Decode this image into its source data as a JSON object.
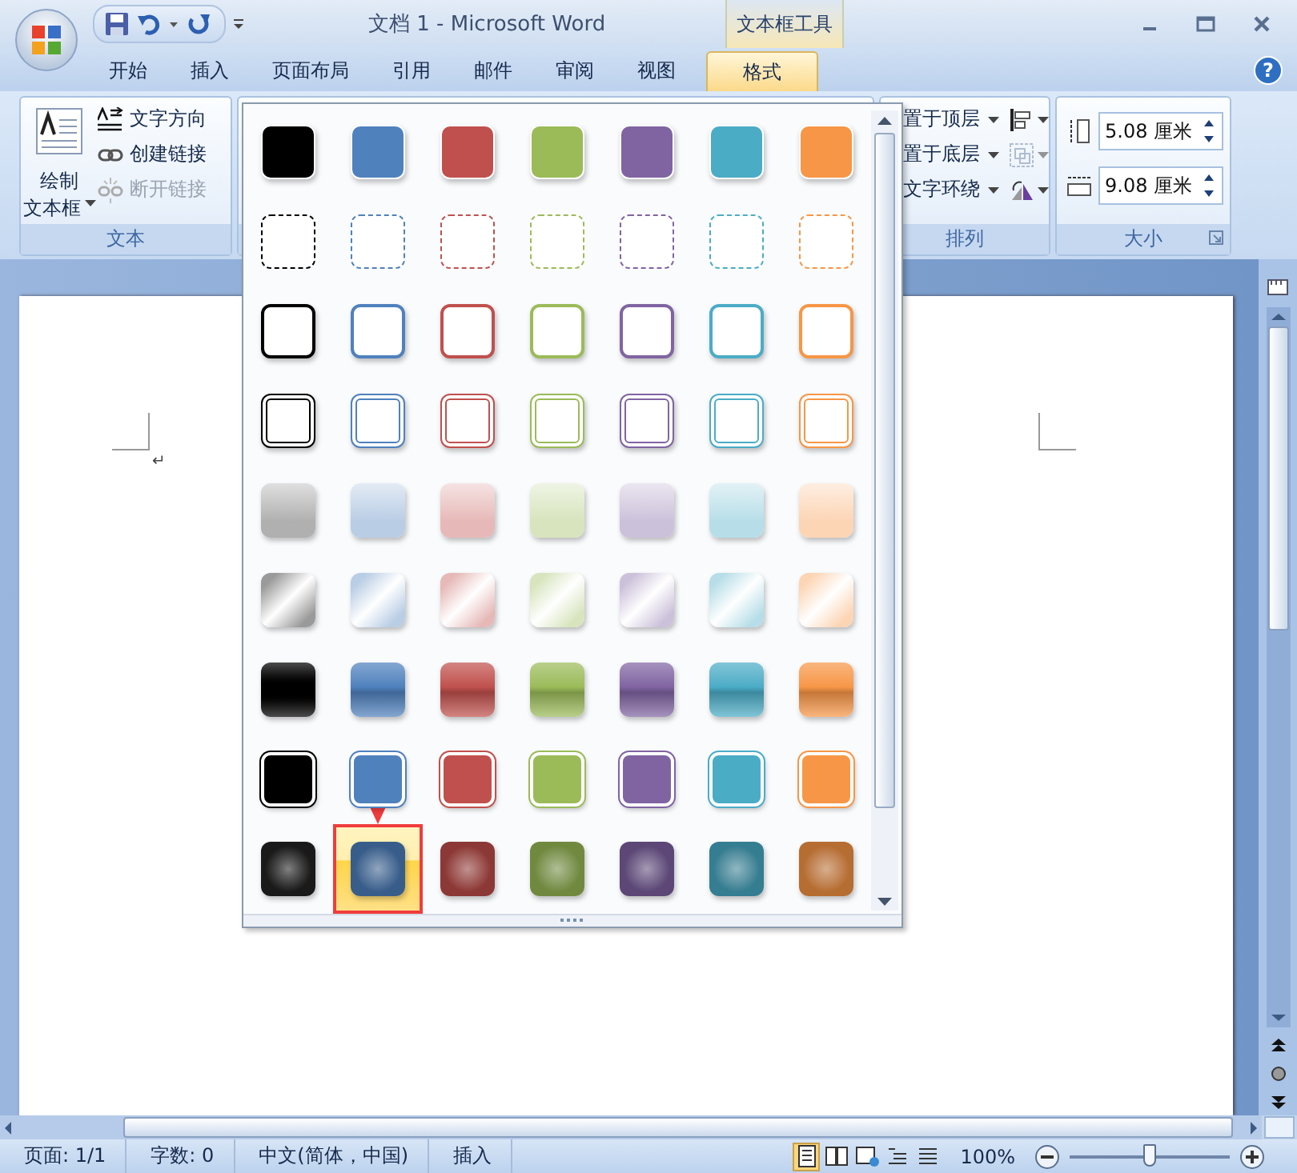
{
  "window": {
    "title": "文档 1 - Microsoft Word",
    "contextual_tab_group": "文本框工具",
    "help_button": "?"
  },
  "tabs": [
    {
      "label": "开始",
      "selected": false
    },
    {
      "label": "插入",
      "selected": false
    },
    {
      "label": "页面布局",
      "selected": false
    },
    {
      "label": "引用",
      "selected": false
    },
    {
      "label": "邮件",
      "selected": false
    },
    {
      "label": "审阅",
      "selected": false
    },
    {
      "label": "视图",
      "selected": false
    },
    {
      "label": "格式",
      "selected": true
    }
  ],
  "ribbon": {
    "text_group": {
      "label": "文本",
      "large_button": [
        "绘制",
        "文本框"
      ],
      "small_buttons": [
        {
          "kind": "direction",
          "label": "文字方向",
          "disabled": false
        },
        {
          "kind": "link",
          "label": "创建链接",
          "disabled": false
        },
        {
          "kind": "unlink",
          "label": "断开链接",
          "disabled": true
        }
      ]
    },
    "arrange_group": {
      "label": "排列",
      "buttons": [
        "置于顶层",
        "置于底层",
        "文字环绕"
      ],
      "side_buttons": [
        {
          "kind": "align",
          "disabled": false
        },
        {
          "kind": "group",
          "disabled": true
        },
        {
          "kind": "rotate",
          "disabled": false
        }
      ]
    },
    "size_group": {
      "label": "大小",
      "fields": [
        {
          "kind": "height",
          "value": "5.08 厘米"
        },
        {
          "kind": "width",
          "value": "9.08 厘米"
        }
      ]
    }
  },
  "gallery": {
    "annotated_selection": true,
    "rows": [
      {
        "kind": "fill",
        "items": [
          {
            "color": "#000000",
            "selected": false
          },
          {
            "color": "#4f81bd",
            "selected": false
          },
          {
            "color": "#c0504d",
            "selected": false
          },
          {
            "color": "#9bbb59",
            "selected": false
          },
          {
            "color": "#8064a2",
            "selected": false
          },
          {
            "color": "#4bacc6",
            "selected": false
          },
          {
            "color": "#f79646",
            "selected": false
          }
        ]
      },
      {
        "kind": "dashed",
        "items": [
          {
            "color": "#000000",
            "selected": false
          },
          {
            "color": "#4f81bd",
            "selected": false
          },
          {
            "color": "#c0504d",
            "selected": false
          },
          {
            "color": "#9bbb59",
            "selected": false
          },
          {
            "color": "#8064a2",
            "selected": false
          },
          {
            "color": "#4bacc6",
            "selected": false
          },
          {
            "color": "#f79646",
            "selected": false
          }
        ]
      },
      {
        "kind": "outline",
        "items": [
          {
            "color": "#000000",
            "selected": false
          },
          {
            "color": "#4f81bd",
            "selected": false
          },
          {
            "color": "#c0504d",
            "selected": false
          },
          {
            "color": "#9bbb59",
            "selected": false
          },
          {
            "color": "#8064a2",
            "selected": false
          },
          {
            "color": "#4bacc6",
            "selected": false
          },
          {
            "color": "#f79646",
            "selected": false
          }
        ]
      },
      {
        "kind": "double",
        "items": [
          {
            "color": "#000000",
            "selected": false
          },
          {
            "color": "#4f81bd",
            "selected": false
          },
          {
            "color": "#c0504d",
            "selected": false
          },
          {
            "color": "#9bbb59",
            "selected": false
          },
          {
            "color": "#8064a2",
            "selected": false
          },
          {
            "color": "#4bacc6",
            "selected": false
          },
          {
            "color": "#f79646",
            "selected": false
          }
        ]
      },
      {
        "kind": "light-gradient",
        "items": [
          {
            "color": "#b0b0b0",
            "selected": false
          },
          {
            "color": "#b9cde5",
            "selected": false
          },
          {
            "color": "#e6b9b8",
            "selected": false
          },
          {
            "color": "#d7e4bd",
            "selected": false
          },
          {
            "color": "#ccc1da",
            "selected": false
          },
          {
            "color": "#b7dee8",
            "selected": false
          },
          {
            "color": "#fcd5b5",
            "selected": false
          }
        ]
      },
      {
        "kind": "diagonal",
        "items": [
          {
            "color": "#9a9a9a",
            "selected": false
          },
          {
            "color": "#b9cde5",
            "selected": false
          },
          {
            "color": "#e6b9b8",
            "selected": false
          },
          {
            "color": "#d7e4bd",
            "selected": false
          },
          {
            "color": "#ccc1da",
            "selected": false
          },
          {
            "color": "#b7dee8",
            "selected": false
          },
          {
            "color": "#fcd5b5",
            "selected": false
          }
        ]
      },
      {
        "kind": "glossy",
        "items": [
          {
            "color": "#000000",
            "selected": false
          },
          {
            "color": "#4f81bd",
            "selected": false
          },
          {
            "color": "#c0504d",
            "selected": false
          },
          {
            "color": "#9bbb59",
            "selected": false
          },
          {
            "color": "#8064a2",
            "selected": false
          },
          {
            "color": "#4bacc6",
            "selected": false
          },
          {
            "color": "#f79646",
            "selected": false
          }
        ]
      },
      {
        "kind": "fill-outlined",
        "items": [
          {
            "color": "#000000",
            "selected": false
          },
          {
            "color": "#4f81bd",
            "selected": false
          },
          {
            "color": "#c0504d",
            "selected": false
          },
          {
            "color": "#9bbb59",
            "selected": false
          },
          {
            "color": "#8064a2",
            "selected": false
          },
          {
            "color": "#4bacc6",
            "selected": false
          },
          {
            "color": "#f79646",
            "selected": false
          }
        ]
      },
      {
        "kind": "intense",
        "items": [
          {
            "color": "#1a1a1a",
            "selected": false
          },
          {
            "color": "#385d8a",
            "selected": true
          },
          {
            "color": "#8c3836",
            "selected": false
          },
          {
            "color": "#71893f",
            "selected": false
          },
          {
            "color": "#5c4776",
            "selected": false
          },
          {
            "color": "#357d91",
            "selected": false
          },
          {
            "color": "#b66d31",
            "selected": false
          }
        ]
      }
    ]
  },
  "document": {
    "paragraph_mark": "↵"
  },
  "status_bar": {
    "items": [
      "页面: 1/1",
      "字数: 0",
      "中文(简体，中国)",
      "插入"
    ],
    "views": [
      {
        "kind": "print",
        "selected": true
      },
      {
        "kind": "reading",
        "selected": false
      },
      {
        "kind": "web",
        "selected": false
      },
      {
        "kind": "outline",
        "selected": false
      },
      {
        "kind": "draft",
        "selected": false
      }
    ],
    "zoom": "100%",
    "zoom_slider": {
      "level": 0.5
    }
  }
}
